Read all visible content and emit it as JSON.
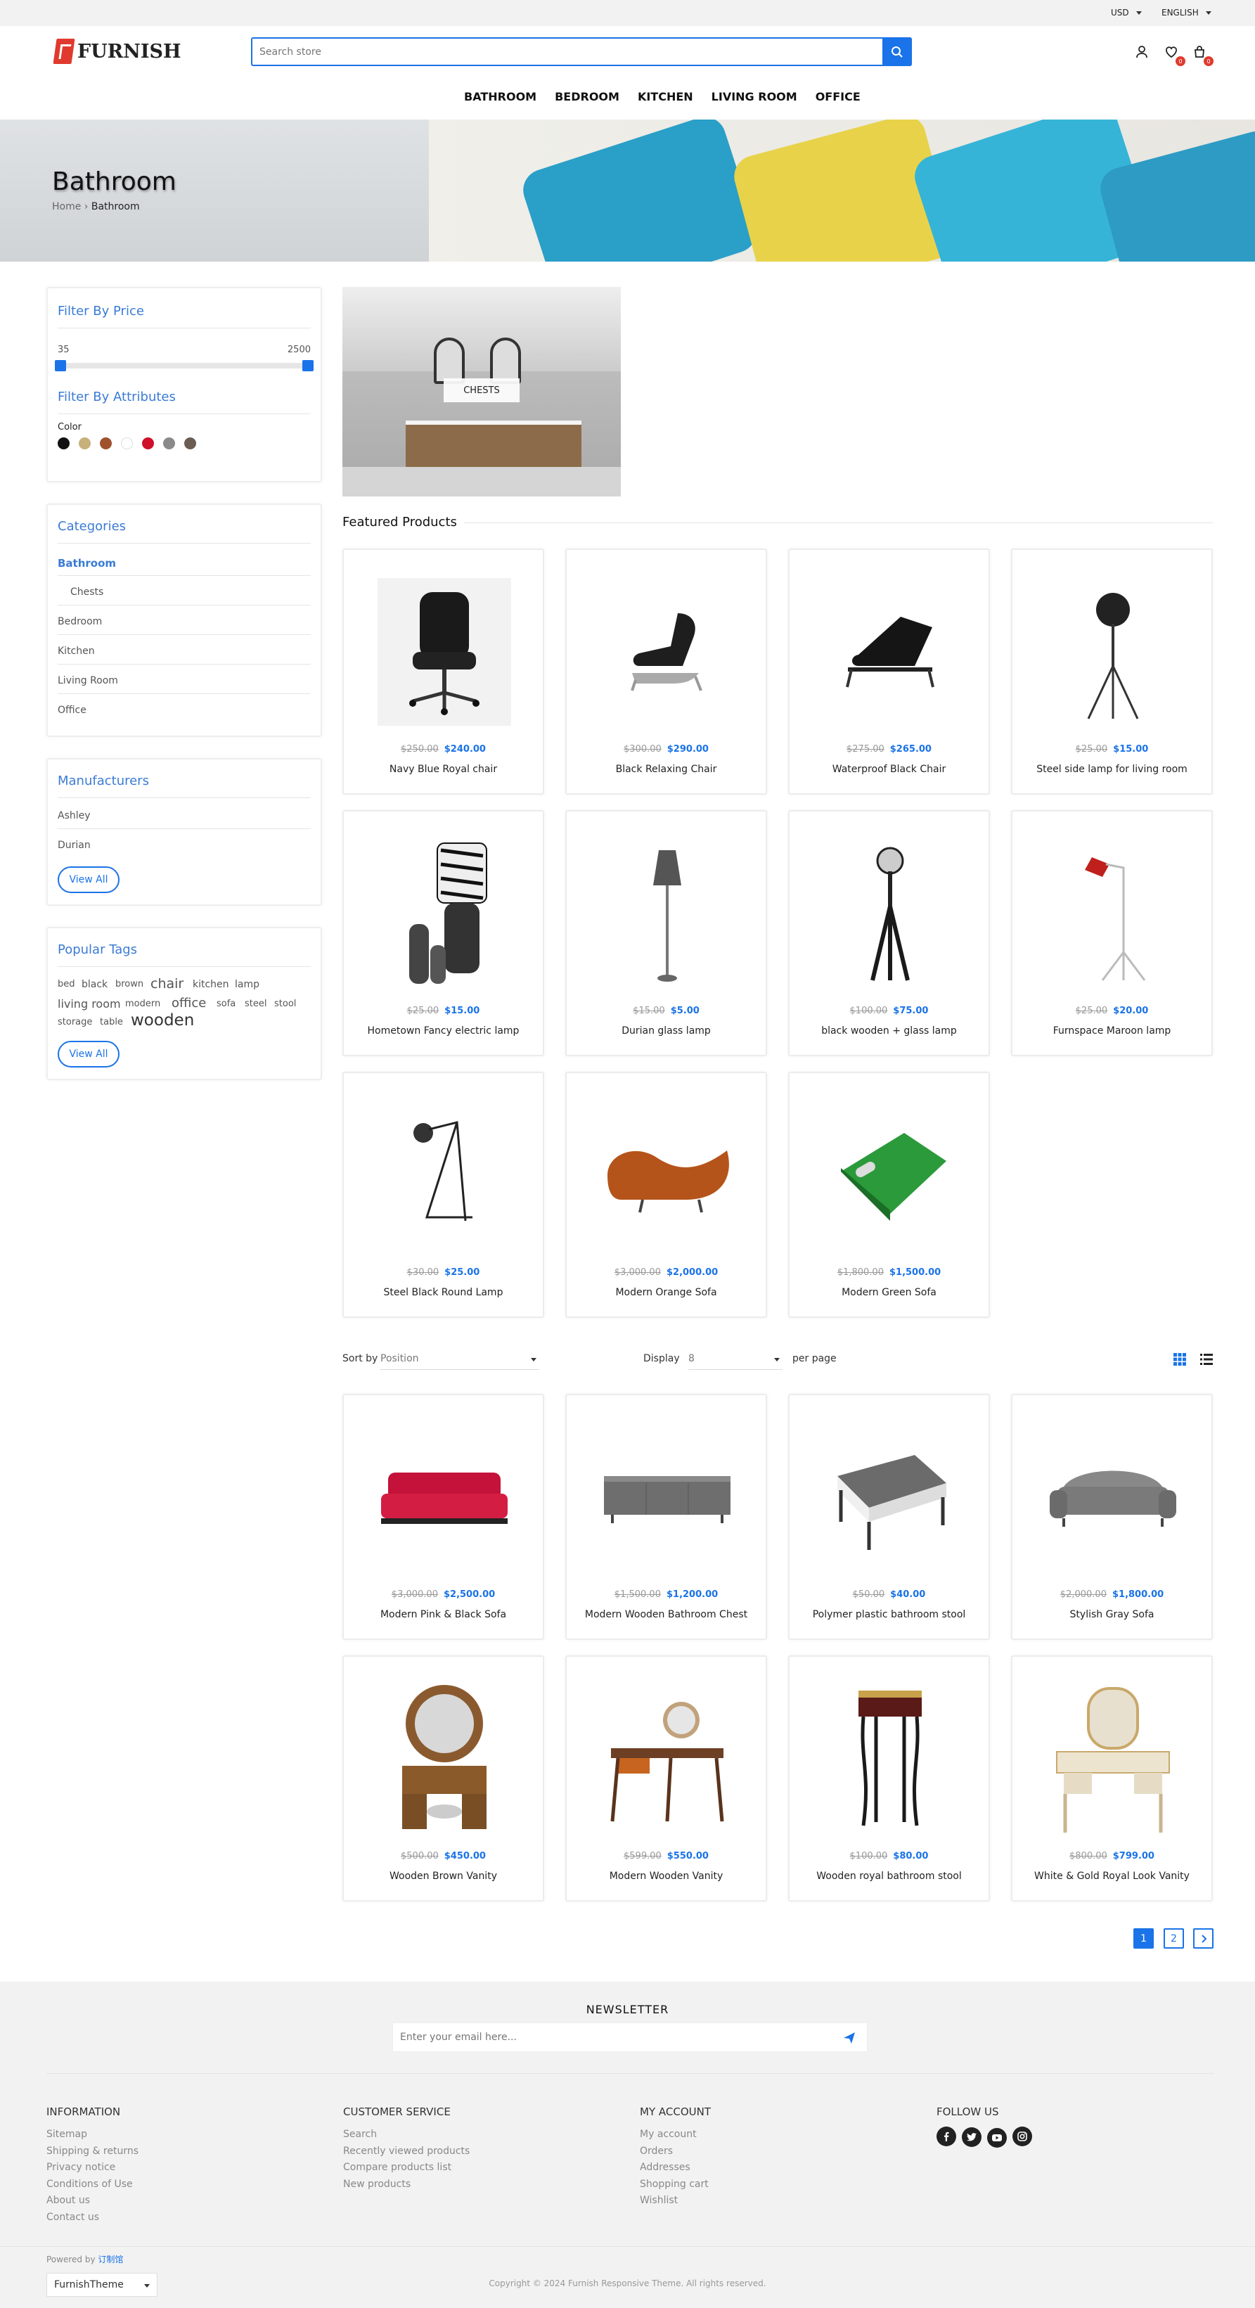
{
  "header": {
    "currency": "USD",
    "language": "ENGLISH",
    "logo_text": "FURNISH",
    "search_placeholder": "Search store",
    "wishlist_count": "0",
    "cart_count": "0",
    "nav": [
      "BATHROOM",
      "BEDROOM",
      "KITCHEN",
      "LIVING ROOM",
      "OFFICE"
    ]
  },
  "hero": {
    "title": "Bathroom",
    "crumb_home": "Home",
    "crumb_sep": "›",
    "crumb_current": "Bathroom"
  },
  "filters": {
    "price_title": "Filter By Price",
    "price_min": "35",
    "price_max": "2500",
    "attr_title": "Filter By Attributes",
    "color_label": "Color",
    "colors": [
      "#111111",
      "#c8b07a",
      "#a0522d",
      "#ffffff",
      "#d0102a",
      "#8a8a8a",
      "#6b5d52"
    ]
  },
  "categories": {
    "title": "Categories",
    "items": [
      "Bathroom",
      "Chests",
      "Bedroom",
      "Kitchen",
      "Living Room",
      "Office"
    ]
  },
  "manufacturers": {
    "title": "Manufacturers",
    "items": [
      "Ashley",
      "Durian"
    ],
    "view_all": "View All"
  },
  "tags": {
    "title": "Popular Tags",
    "items": [
      "bed",
      "black",
      "brown",
      "chair",
      "kitchen",
      "lamp",
      "living room",
      "modern",
      "office",
      "sofa",
      "steel",
      "stool",
      "storage",
      "table",
      "wooden"
    ],
    "view_all": "View All"
  },
  "subcategory": {
    "label": "CHESTS"
  },
  "featured": {
    "title": "Featured Products",
    "products": [
      {
        "name": "Navy Blue Royal chair",
        "old": "$250.00",
        "price": "$240.00",
        "icon": "office-chair"
      },
      {
        "name": "Black Relaxing Chair",
        "old": "$300.00",
        "price": "$290.00",
        "icon": "lounge-chair"
      },
      {
        "name": "Waterproof Black Chair",
        "old": "$275.00",
        "price": "$265.00",
        "icon": "lounge-chair-2"
      },
      {
        "name": "Steel side lamp for living room",
        "old": "$25.00",
        "price": "$15.00",
        "icon": "tripod-lamp"
      },
      {
        "name": "Hometown Fancy electric lamp",
        "old": "$25.00",
        "price": "$15.00",
        "icon": "zebra-lamp"
      },
      {
        "name": "Durian glass lamp",
        "old": "$15.00",
        "price": "$5.00",
        "icon": "floor-lamp"
      },
      {
        "name": "black wooden + glass lamp",
        "old": "$100.00",
        "price": "$75.00",
        "icon": "tripod-spot-lamp"
      },
      {
        "name": "Furnspace Maroon lamp",
        "old": "$25.00",
        "price": "$20.00",
        "icon": "red-lamp"
      },
      {
        "name": "Steel Black Round Lamp",
        "old": "$30.00",
        "price": "$25.00",
        "icon": "desk-lamp"
      },
      {
        "name": "Modern Orange Sofa",
        "old": "$3,000.00",
        "price": "$2,000.00",
        "icon": "orange-sofa"
      },
      {
        "name": "Modern Green Sofa",
        "old": "$1,800.00",
        "price": "$1,500.00",
        "icon": "green-sofa"
      }
    ]
  },
  "toolbar": {
    "sort_label": "Sort by",
    "sort_value": "Position",
    "display_label": "Display",
    "display_value": "8",
    "per_page": "per page"
  },
  "products": [
    {
      "name": "Modern Pink & Black Sofa",
      "old": "$3,000.00",
      "price": "$2,500.00",
      "icon": "red-sofa"
    },
    {
      "name": "Modern Wooden Bathroom Chest",
      "old": "$1,500.00",
      "price": "$1,200.00",
      "icon": "grey-chest"
    },
    {
      "name": "Polymer plastic bathroom stool",
      "old": "$50.00",
      "price": "$40.00",
      "icon": "bench"
    },
    {
      "name": "Stylish Gray Sofa",
      "old": "$2,000.00",
      "price": "$1,800.00",
      "icon": "grey-sofa"
    },
    {
      "name": "Wooden Brown Vanity",
      "old": "$500.00",
      "price": "$450.00",
      "icon": "brown-vanity"
    },
    {
      "name": "Modern Wooden Vanity",
      "old": "$599.00",
      "price": "$550.00",
      "icon": "modern-vanity"
    },
    {
      "name": "Wooden royal bathroom stool",
      "old": "$100.00",
      "price": "$80.00",
      "icon": "royal-stool"
    },
    {
      "name": "White & Gold Royal Look Vanity",
      "old": "$800.00",
      "price": "$799.00",
      "icon": "white-vanity"
    }
  ],
  "pagination": {
    "pages": [
      "1",
      "2"
    ]
  },
  "footer": {
    "newsletter_title": "NEWSLETTER",
    "newsletter_placeholder": "Enter your email here...",
    "information": {
      "title": "INFORMATION",
      "links": [
        "Sitemap",
        "Shipping & returns",
        "Privacy notice",
        "Conditions of Use",
        "About us",
        "Contact us"
      ]
    },
    "service": {
      "title": "CUSTOMER SERVICE",
      "links": [
        "Search",
        "Recently viewed products",
        "Compare products list",
        "New products"
      ]
    },
    "account": {
      "title": "MY ACCOUNT",
      "links": [
        "My account",
        "Orders",
        "Addresses",
        "Shopping cart",
        "Wishlist"
      ]
    },
    "follow": {
      "title": "FOLLOW US"
    },
    "powered_by": "Powered by",
    "powered_name": "订制馆",
    "theme_value": "FurnishTheme",
    "copyright": "Copyright © 2024 Furnish Responsive Theme. All rights reserved."
  }
}
